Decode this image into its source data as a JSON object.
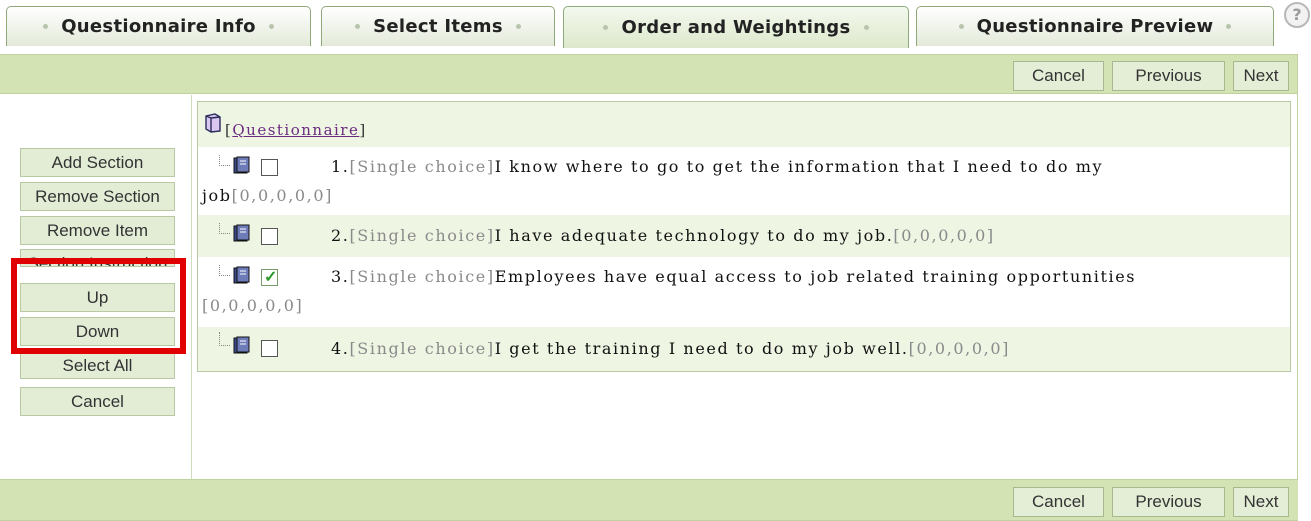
{
  "tabs": [
    {
      "label": "Questionnaire Info",
      "active": false
    },
    {
      "label": "Select Items",
      "active": false
    },
    {
      "label": "Order and Weightings",
      "active": true
    },
    {
      "label": "Questionnaire Preview",
      "active": false
    }
  ],
  "help_label": "?",
  "toolbar": {
    "cancel": "Cancel",
    "previous": "Previous",
    "next": "Next"
  },
  "actions": {
    "add_section": "Add Section",
    "remove_section": "Remove Section",
    "remove_item": "Remove Item",
    "section_instruction": "Section Instruction",
    "up": "Up",
    "down": "Down",
    "select_all": "Select All",
    "cancel": "Cancel"
  },
  "tree": {
    "root_open": "[",
    "root_label": "Questionnaire",
    "root_close": "]",
    "items": [
      {
        "number": "1.",
        "type": "[Single choice]",
        "text_line1": "I know where to go to get the information that I need to do my",
        "text_line2": "job",
        "weights": "[0,0,0,0,0]",
        "checked": false
      },
      {
        "number": "2.",
        "type": "[Single choice]",
        "text_line1": "I have adequate technology to do my job.",
        "weights": "[0,0,0,0,0]",
        "checked": false
      },
      {
        "number": "3.",
        "type": "[Single choice]",
        "text_line1": "Employees have equal access to job related training opportunities",
        "text_line2": "",
        "weights": "[0,0,0,0,0]",
        "checked": true
      },
      {
        "number": "4.",
        "type": "[Single choice]",
        "text_line1": "I get the training I need to do my job well.",
        "weights": "[0,0,0,0,0]",
        "checked": false
      }
    ]
  },
  "colors": {
    "toolbar_bg": "#d3e3b3",
    "highlight_border": "#e00000",
    "link": "#6b2a80",
    "check": "#2a9a2a"
  }
}
